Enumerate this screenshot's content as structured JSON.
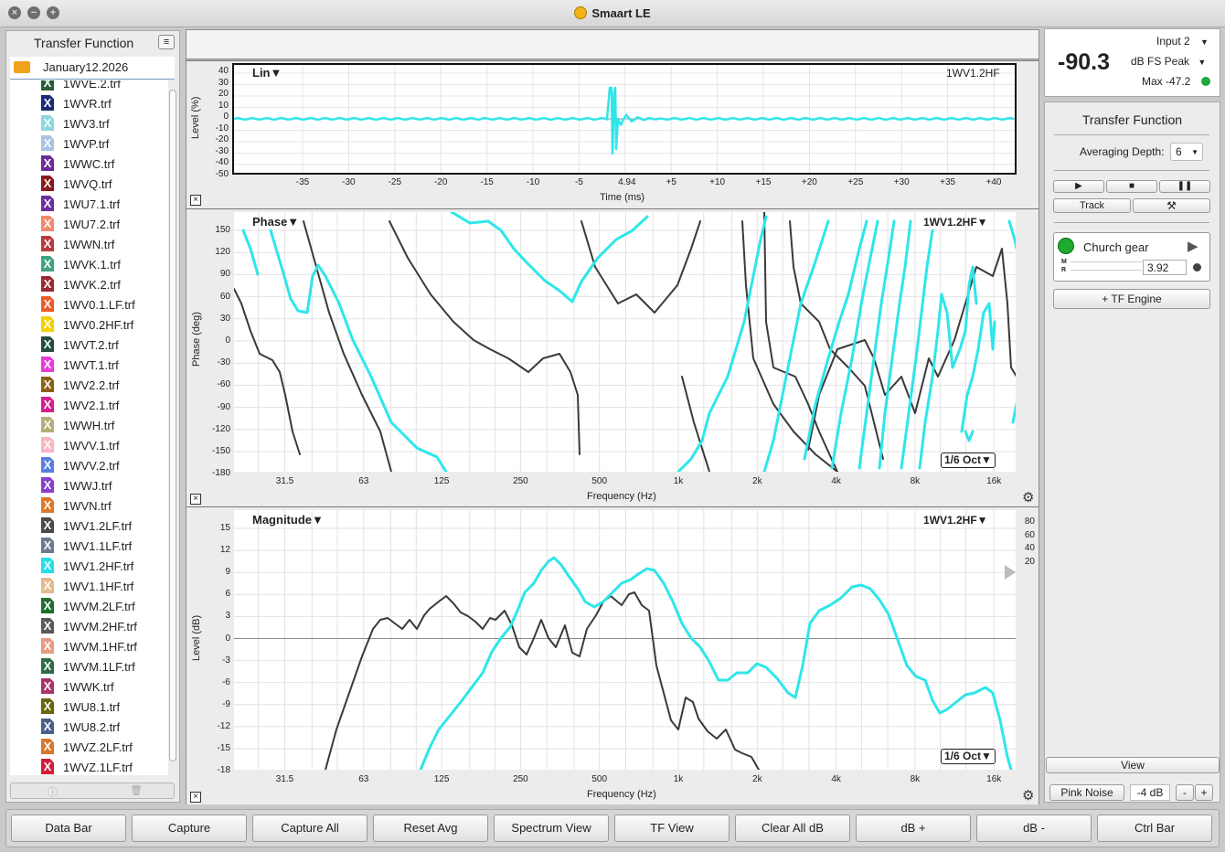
{
  "window": {
    "title": "Smaart LE"
  },
  "sidebar": {
    "title": "Transfer Function",
    "folder": "January12.2026",
    "files": [
      {
        "name": "1WVE.2.trf",
        "color": "#2a5d3a"
      },
      {
        "name": "1WVR.trf",
        "color": "#1c2a78"
      },
      {
        "name": "1WV3.trf",
        "color": "#8ed6e0"
      },
      {
        "name": "1WVP.trf",
        "color": "#a9c4e3"
      },
      {
        "name": "1WWC.trf",
        "color": "#6b2c9a"
      },
      {
        "name": "1WVQ.trf",
        "color": "#8a1a1a"
      },
      {
        "name": "1WU7.1.trf",
        "color": "#6c2fa0"
      },
      {
        "name": "1WU7.2.trf",
        "color": "#f08a6a"
      },
      {
        "name": "1WWN.trf",
        "color": "#b83a3a"
      },
      {
        "name": "1WVK.1.trf",
        "color": "#3fa37b"
      },
      {
        "name": "1WVK.2.trf",
        "color": "#9a2a30"
      },
      {
        "name": "1WV0.1.LF.trf",
        "color": "#ef5a29"
      },
      {
        "name": "1WV0.2HF.trf",
        "color": "#f5d000"
      },
      {
        "name": "1WVT.2.trf",
        "color": "#264d3c"
      },
      {
        "name": "1WVT.1.trf",
        "color": "#e83bd6"
      },
      {
        "name": "1WV2.2.trf",
        "color": "#8a6214"
      },
      {
        "name": "1WV2.1.trf",
        "color": "#d61e8e"
      },
      {
        "name": "1WWH.trf",
        "color": "#b7ad7a"
      },
      {
        "name": "1WVV.1.trf",
        "color": "#f5b7c2"
      },
      {
        "name": "1WVV.2.trf",
        "color": "#5a7fe0"
      },
      {
        "name": "1WWJ.trf",
        "color": "#8a3fd0"
      },
      {
        "name": "1WVN.trf",
        "color": "#e0772a"
      },
      {
        "name": "1WV1.2LF.trf",
        "color": "#4a4a4a"
      },
      {
        "name": "1WV1.1LF.trf",
        "color": "#6a7a90"
      },
      {
        "name": "1WV1.2HF.trf",
        "color": "#22e0e8"
      },
      {
        "name": "1WV1.1HF.trf",
        "color": "#e6b98f"
      },
      {
        "name": "1WVM.2LF.trf",
        "color": "#1f6f2f"
      },
      {
        "name": "1WVM.2HF.trf",
        "color": "#555b5f"
      },
      {
        "name": "1WVM.1HF.trf",
        "color": "#e89a80"
      },
      {
        "name": "1WVM.1LF.trf",
        "color": "#2f6a4a"
      },
      {
        "name": "1WWK.trf",
        "color": "#a8356a"
      },
      {
        "name": "1WU8.1.trf",
        "color": "#6b6410"
      },
      {
        "name": "1WU8.2.trf",
        "color": "#4a5e8a"
      },
      {
        "name": "1WVZ.2LF.trf",
        "color": "#d4782f"
      },
      {
        "name": "1WVZ.1LF.trf",
        "color": "#d41c3a"
      }
    ]
  },
  "meter": {
    "input": "Input 2",
    "value": "-90.3",
    "unit": "dB FS Peak",
    "max": "Max -47.2",
    "status_color": "#1ea83a"
  },
  "right_panel": {
    "title": "Transfer Function",
    "averaging_label": "Averaging Depth:",
    "averaging_value": "6",
    "track_label": "Track",
    "engine_name": "Church gear",
    "m_label": "M",
    "r_label": "R",
    "delay_value": "3.92",
    "add_engine": "+ TF Engine",
    "view_label": "View",
    "pink_noise_label": "Pink Noise",
    "pink_noise_level": "-4 dB",
    "minus": "-",
    "plus": "+"
  },
  "plots": {
    "impulse": {
      "title": "Lin▼",
      "trace": "1WV1.2HF",
      "ylabel": "Level (%)",
      "xlabel": "Time (ms)",
      "yticks": [
        "40",
        "30",
        "20",
        "10",
        "0",
        "-10",
        "-20",
        "-30",
        "-40",
        "-50"
      ],
      "xticks": [
        "-35",
        "-30",
        "-25",
        "-20",
        "-15",
        "-10",
        "-5",
        "4.94",
        "+5",
        "+10",
        "+15",
        "+20",
        "+25",
        "+30",
        "+35",
        "+40"
      ]
    },
    "phase": {
      "title": "Phase▼",
      "trace": "1WV1.2HF▼",
      "ylabel": "Phase (deg)",
      "xlabel": "Frequency (Hz)",
      "smoothing": "1/6 Oct▼",
      "yticks": [
        "150",
        "120",
        "90",
        "60",
        "30",
        "0",
        "-30",
        "-60",
        "-90",
        "-120",
        "-150",
        "-180"
      ],
      "xticks": [
        "31.5",
        "63",
        "125",
        "250",
        "500",
        "1k",
        "2k",
        "4k",
        "8k",
        "16k"
      ]
    },
    "magnitude": {
      "title": "Magnitude▼",
      "trace": "1WV1.2HF▼",
      "ylabel": "Level (dB)",
      "xlabel": "Frequency (Hz)",
      "smoothing": "1/6 Oct▼",
      "yticks": [
        "15",
        "12",
        "9",
        "6",
        "3",
        "0",
        "-3",
        "-6",
        "-9",
        "-12",
        "-15",
        "-18"
      ],
      "coherence_ticks": [
        "80",
        "60",
        "40",
        "20"
      ],
      "xticks": [
        "31.5",
        "63",
        "125",
        "250",
        "500",
        "1k",
        "2k",
        "4k",
        "8k",
        "16k"
      ]
    }
  },
  "bottom_buttons": [
    "Data Bar",
    "Capture",
    "Capture All",
    "Reset Avg",
    "Spectrum View",
    "TF View",
    "Clear All dB",
    "dB +",
    "dB -",
    "Ctrl Bar"
  ],
  "colors": {
    "trace_cyan": "#2ee6ea",
    "trace_dark": "#3a3a3a"
  }
}
